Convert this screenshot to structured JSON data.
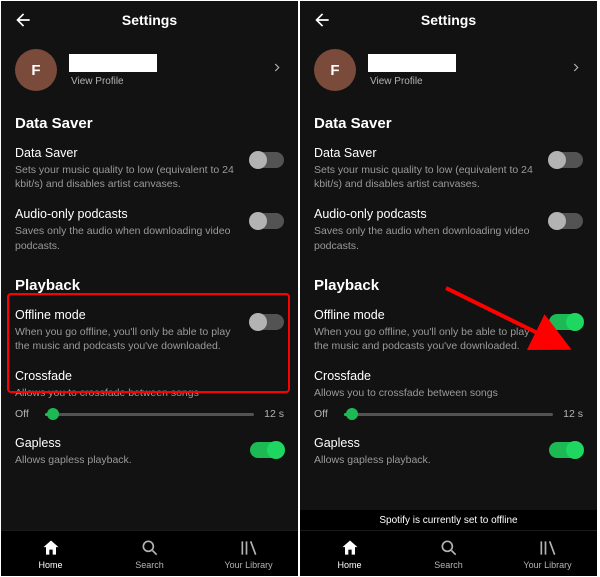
{
  "header": {
    "title": "Settings"
  },
  "profile": {
    "initial": "F",
    "view_profile": "View Profile"
  },
  "sections": {
    "data_saver": {
      "title": "Data Saver",
      "items": {
        "data_saver": {
          "label": "Data Saver",
          "desc": "Sets your music quality to low (equivalent to 24 kbit/s) and disables artist canvases.",
          "on": false
        },
        "audio_only": {
          "label": "Audio-only podcasts",
          "desc": "Saves only the audio when downloading video podcasts.",
          "on": false
        }
      }
    },
    "playback": {
      "title": "Playback",
      "offline": {
        "label": "Offline mode",
        "desc": "When you go offline, you'll only be able to play the music and podcasts you've downloaded.",
        "on_left": false,
        "on_right": true
      },
      "crossfade": {
        "label": "Crossfade",
        "desc": "Allows you to crossfade between songs",
        "min_label": "Off",
        "max_label": "12 s"
      },
      "gapless": {
        "label": "Gapless",
        "desc": "Allows gapless playback.",
        "on": true
      }
    }
  },
  "tabs": {
    "home": "Home",
    "search": "Search",
    "library": "Your Library"
  },
  "toast": "Spotify is currently set to offline"
}
